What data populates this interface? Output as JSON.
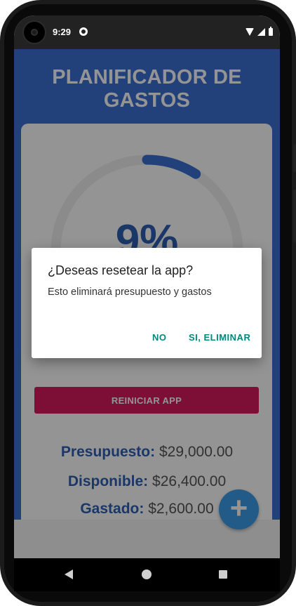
{
  "status_bar": {
    "time": "9:29",
    "icons": [
      "camera-icon",
      "app-notification-icon",
      "wifi-icon",
      "signal-icon",
      "battery-icon"
    ]
  },
  "app": {
    "title": "PLANIFICADOR DE GASTOS",
    "progress": {
      "percent_text": "9%",
      "value": 0.09,
      "ring_color": "#3b6fd0",
      "track_color": "#f0f0f0"
    },
    "reset_button_label": "REINICIAR APP",
    "summary": {
      "budget_label": "Presupuesto:",
      "budget_value": "$29,000.00",
      "available_label": "Disponible:",
      "available_value": "$26,400.00",
      "spent_label": "Gastado:",
      "spent_value": "$2,600.00"
    },
    "fab_label": "+"
  },
  "dialog": {
    "title": "¿Deseas resetear la app?",
    "message": "Esto eliminará presupuesto y gastos",
    "cancel_label": "NO",
    "confirm_label": "SI, ELIMINAR"
  },
  "nav_bar": {
    "icons": [
      "back-icon",
      "home-icon",
      "recents-icon"
    ]
  },
  "colors": {
    "primary": "#3b6fd0",
    "accent_pink": "#d81b60",
    "fab_blue": "#3b9ee8",
    "dialog_button": "#00897b"
  }
}
